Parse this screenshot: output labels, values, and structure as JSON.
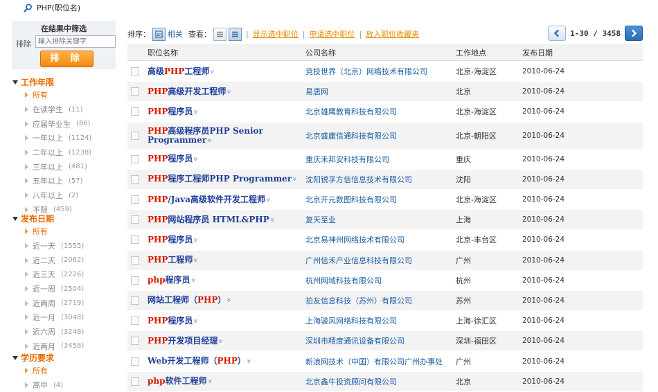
{
  "search": {
    "keyword": "PHP(职位名)"
  },
  "sidebar": {
    "filter_title": "在结果中筛选",
    "exclude_label": "排除",
    "exclude_placeholder": "输入排除关键字",
    "exclude_button": "排 除",
    "facets": [
      {
        "title": "工作年限",
        "items": [
          {
            "label": "所有",
            "count": "",
            "selected": true
          },
          {
            "label": "在读学生",
            "count": "(11)"
          },
          {
            "label": "应届毕业生",
            "count": "(86)"
          },
          {
            "label": "一年以上",
            "count": "(1124)"
          },
          {
            "label": "二年以上",
            "count": "(1238)"
          },
          {
            "label": "三年以上",
            "count": "(481)"
          },
          {
            "label": "五年以上",
            "count": "(57)"
          },
          {
            "label": "八年以上",
            "count": "(2)"
          },
          {
            "label": "不限",
            "count": "(459)"
          }
        ]
      },
      {
        "title": "发布日期",
        "items": [
          {
            "label": "所有",
            "count": "",
            "selected": true
          },
          {
            "label": "近一天",
            "count": "(1555)"
          },
          {
            "label": "近二天",
            "count": "(2062)"
          },
          {
            "label": "近三天",
            "count": "(2226)"
          },
          {
            "label": "近一周",
            "count": "(2504)"
          },
          {
            "label": "近两周",
            "count": "(2719)"
          },
          {
            "label": "近一月",
            "count": "(3048)"
          },
          {
            "label": "近六周",
            "count": "(3248)"
          },
          {
            "label": "近两月",
            "count": "(3458)"
          }
        ]
      },
      {
        "title": "学历要求",
        "items": [
          {
            "label": "所有",
            "count": "",
            "selected": true
          },
          {
            "label": "高中",
            "count": "(4)"
          }
        ]
      }
    ]
  },
  "toolbar": {
    "sort_label": "排序：",
    "relevance_label": "相关",
    "view_label": "查看：",
    "separator": "|",
    "link_show_selected": "显示选中职位",
    "link_apply_selected": "申请选中职位",
    "link_favorite": "放入职位收藏夹",
    "page_range": "1-30 / 3458"
  },
  "table": {
    "headers": {
      "title": "职位名称",
      "company": "公司名称",
      "location": "工作地点",
      "date": "发布日期"
    },
    "rows": [
      {
        "title": [
          [
            "高级",
            false
          ],
          [
            "PHP",
            true
          ],
          [
            "工程师",
            false
          ]
        ],
        "company": "竞技世界（北京）网络技术有限公司",
        "location": "北京-海淀区",
        "date": "2010-06-24"
      },
      {
        "title": [
          [
            "PHP",
            true
          ],
          [
            "高级开发工程师",
            false
          ]
        ],
        "company": "易唐网",
        "location": "北京",
        "date": "2010-06-24"
      },
      {
        "title": [
          [
            "PHP",
            true
          ],
          [
            "程序员",
            false
          ]
        ],
        "company": "北京雄鹰教育科技有限公司",
        "location": "北京-海淀区",
        "date": "2010-06-24"
      },
      {
        "title": [
          [
            "PHP",
            true
          ],
          [
            "高级程序员PHP Senior Programmer",
            false
          ]
        ],
        "company": "北京盛庸信通科技有限公司",
        "location": "北京-朝阳区",
        "date": "2010-06-24",
        "tall": true
      },
      {
        "title": [
          [
            "PHP",
            true
          ],
          [
            "程序员",
            false
          ]
        ],
        "company": "重庆禾邦安科技有限公司",
        "location": "重庆",
        "date": "2010-06-24"
      },
      {
        "title": [
          [
            "PHP",
            true
          ],
          [
            "程序工程师PHP Programmer",
            false
          ]
        ],
        "company": "沈阳锐孚方信信息技术有限公司",
        "location": "沈阳",
        "date": "2010-06-24"
      },
      {
        "title": [
          [
            "PHP",
            true
          ],
          [
            "/Java高级软件开发工程师",
            false
          ]
        ],
        "company": "北京开元数图科技有限公司",
        "location": "北京-海淀区",
        "date": "2010-06-24"
      },
      {
        "title": [
          [
            "PHP",
            true
          ],
          [
            "网站程序员 HTML&PHP",
            false
          ]
        ],
        "company": "复天至业",
        "location": "上海",
        "date": "2010-06-24"
      },
      {
        "title": [
          [
            "PHP",
            true
          ],
          [
            "程序员",
            false
          ]
        ],
        "company": "北京易神州网络技术有限公司",
        "location": "北京-丰台区",
        "date": "2010-06-24"
      },
      {
        "title": [
          [
            "PHP",
            true
          ],
          [
            "工程师",
            false
          ]
        ],
        "company": "广州信禾产业信息科技有限公司",
        "location": "广州",
        "date": "2010-06-24"
      },
      {
        "title": [
          [
            "php",
            true
          ],
          [
            "程序员",
            false
          ]
        ],
        "company": "杭州网域科技有限公司",
        "location": "杭州",
        "date": "2010-06-24"
      },
      {
        "title": [
          [
            "网站工程师（",
            false
          ],
          [
            "PHP",
            true
          ],
          [
            "）",
            false
          ]
        ],
        "company": "拍友信息科技（苏州）有限公司",
        "location": "苏州",
        "date": "2010-06-24"
      },
      {
        "title": [
          [
            "PHP",
            true
          ],
          [
            "程序员",
            false
          ]
        ],
        "company": "上海骏风网络科技有限公司",
        "location": "上海-徐汇区",
        "date": "2010-06-24"
      },
      {
        "title": [
          [
            "PHP",
            true
          ],
          [
            "开发项目经理",
            false
          ]
        ],
        "company": "深圳市精度通讯设备有限公司",
        "location": "深圳-福田区",
        "date": "2010-06-24"
      },
      {
        "title": [
          [
            "Web开发工程师（",
            false
          ],
          [
            "PHP",
            true
          ],
          [
            "）",
            false
          ]
        ],
        "company": "新浪网技术（中国）有限公司广州办事处",
        "location": "广州",
        "date": "2010-06-24"
      },
      {
        "title": [
          [
            "php",
            true
          ],
          [
            "软件工程师",
            false
          ]
        ],
        "company": "北京鑫牛投资顾问有限公司",
        "location": "北京",
        "date": "2010-06-24"
      }
    ]
  },
  "colors": {
    "accent_orange": "#e86a00",
    "link_blue": "#1f3f99",
    "highlight_red": "#d41a00"
  },
  "icons": {
    "search": "search-icon",
    "chevron": "double-chevron-down-icon"
  }
}
